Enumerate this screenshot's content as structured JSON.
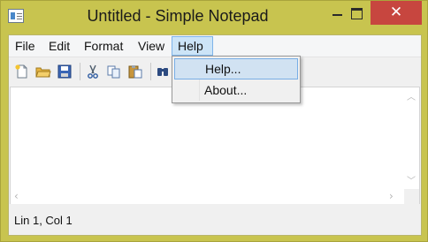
{
  "window": {
    "title": "Untitled - Simple Notepad"
  },
  "titlebar_buttons": {
    "close_glyph": "✕"
  },
  "menubar": {
    "items": [
      {
        "label": "File"
      },
      {
        "label": "Edit"
      },
      {
        "label": "Format"
      },
      {
        "label": "View"
      },
      {
        "label": "Help",
        "active": true
      }
    ]
  },
  "help_menu": {
    "items": [
      {
        "label": "Help...",
        "highlighted": true
      },
      {
        "label": "About..."
      }
    ]
  },
  "toolbar": {
    "buttons": [
      "new-file-icon",
      "open-folder-icon",
      "save-icon",
      "cut-icon",
      "copy-icon",
      "paste-icon",
      "find-icon"
    ]
  },
  "editor": {
    "content": ""
  },
  "statusbar": {
    "position": "Lin 1, Col 1"
  },
  "colors": {
    "accent_border": "#c8c44f",
    "close_button": "#c7463f",
    "menu_highlight": "#cce4f7",
    "menu_highlight_border": "#7eb4ea"
  }
}
